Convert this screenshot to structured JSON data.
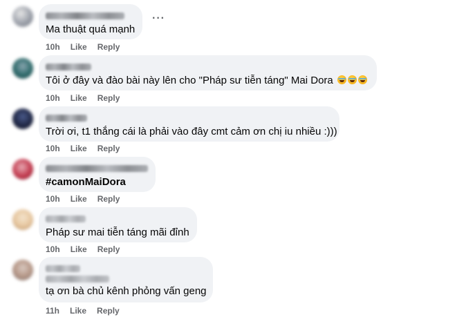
{
  "comments": [
    {
      "text": "Ma thuật quá mạnh",
      "time": "10h",
      "like": "Like",
      "reply": "Reply",
      "more": "···",
      "avatar_colors": [
        "#c9c9c9",
        "#8a8f99",
        "#e2e2e2"
      ]
    },
    {
      "text": "Tôi ở đây và đào bài này lên cho \"Pháp sư tiễn táng\" Mai Dora",
      "emoji_name": "rolling-on-floor-laughing",
      "time": "10h",
      "like": "Like",
      "reply": "Reply",
      "avatar_colors": [
        "#2f6b6b",
        "#8aa6b0",
        "#1f3d45"
      ]
    },
    {
      "text": "Trời ơi, t1 thắng cái là phải vào đây cmt cảm ơn chị iu nhiều :)))",
      "time": "10h",
      "like": "Like",
      "reply": "Reply",
      "avatar_colors": [
        "#1d2440",
        "#3a4a7a",
        "#0e1326"
      ]
    },
    {
      "text": "#camonMaiDora",
      "time": "10h",
      "like": "Like",
      "reply": "Reply",
      "avatar_colors": [
        "#c23a4e",
        "#e7a9b3",
        "#7a1f2e"
      ]
    },
    {
      "text": "Pháp sư mai tiễn táng mãi đỉnh",
      "time": "10h",
      "like": "Like",
      "reply": "Reply",
      "avatar_colors": [
        "#e8c9a3",
        "#b48a5e",
        "#f3e3cc"
      ]
    },
    {
      "text": "tạ ơn bà chủ kênh phỏng vấn geng",
      "time": "11h",
      "like": "Like",
      "reply": "Reply",
      "avatar_colors": [
        "#b89a8a",
        "#7a6a66",
        "#d8c8c0"
      ]
    }
  ]
}
